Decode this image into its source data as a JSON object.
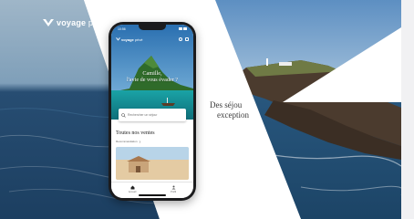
{
  "brand": {
    "name_bold": "voyage",
    "name_light": "privé"
  },
  "right_headline": {
    "line1": "Des séjou",
    "line2": "exception"
  },
  "phone": {
    "status_time": "10:56",
    "app_logo_bold": "voyage",
    "app_logo_light": "privé",
    "hero_title_line1": "Camille,",
    "hero_title_line2": "l'avie de vous évader ?",
    "search_placeholder": "Rechercher un séjour",
    "section_title": "Toutes nos ventes",
    "section_subtitle": "Recommandation",
    "tabs": [
      {
        "label": "Accueil",
        "icon": "home-icon"
      },
      {
        "label": "Profil",
        "icon": "person-icon"
      }
    ]
  },
  "colors": {
    "ocean": "#2a5a82",
    "sky": "#6e9cc6",
    "cliff": "#4b3b2e",
    "cliff_grass": "#6f7a45",
    "background": "#ffffff"
  }
}
